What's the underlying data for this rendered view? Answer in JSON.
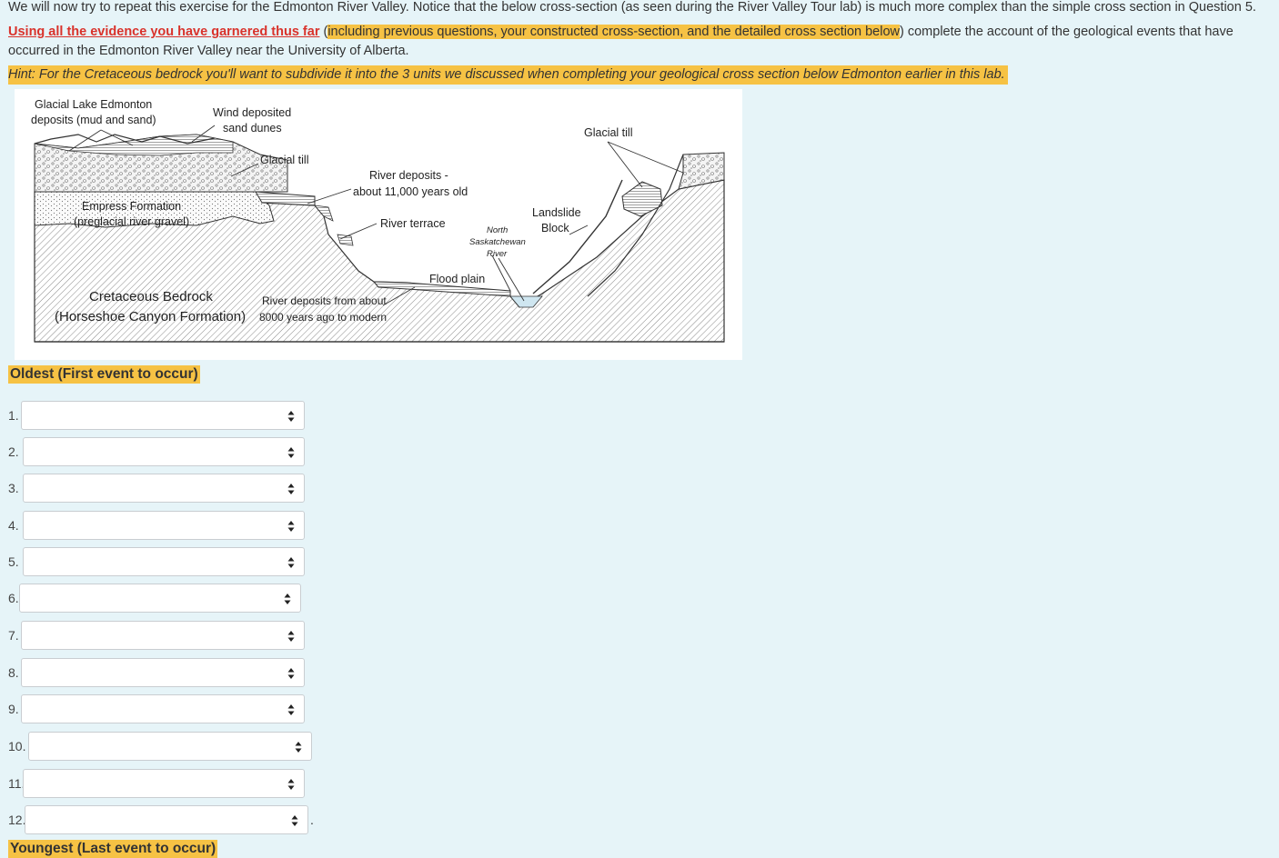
{
  "intro": "We will now try to repeat this exercise for the Edmonton River Valley. Notice that the below cross-section (as seen during the River Valley Tour lab) is much more complex than the simple cross section in Question 5.",
  "instruction": {
    "red": "Using all the evidence you have garnered thus far",
    "open_paren": " (",
    "highlight": "including previous questions, your constructed cross-section, and the detailed cross section below",
    "rest": ") complete the account of the geological events that have occurred in the Edmonton River Valley near the University of Alberta."
  },
  "hint": "Hint: For the Cretaceous bedrock you'll want to subdivide it into the 3 units we discussed when completing your geological cross section below Edmonton earlier in this lab.",
  "figure": {
    "glacial_lake_1": "Glacial Lake Edmonton",
    "glacial_lake_2": "deposits (mud and sand)",
    "wind_1": "Wind deposited",
    "wind_2": "sand dunes",
    "glacial_till_left": "Glacial till",
    "glacial_till_right": "Glacial till",
    "river_dep_1": "River deposits -",
    "river_dep_2": "about 11,000 years old",
    "empress_1": "Empress Formation",
    "empress_2": "(preglacial river gravel)",
    "river_terrace": "River terrace",
    "nsr_1": "North",
    "nsr_2": "Saskatchewan",
    "nsr_3": "River",
    "landslide_1": "Landslide",
    "landslide_2": "Block",
    "flood_plain": "Flood plain",
    "bedrock_1": "Cretaceous Bedrock",
    "bedrock_2": "(Horseshoe Canyon Formation)",
    "river_8000_1": "River deposits from about",
    "river_8000_2": "8000 years ago to modern"
  },
  "oldest_label": "Oldest (First event to occur)",
  "youngest_label": "Youngest (Last event to occur)",
  "events": [
    {
      "num": "1.",
      "value": ""
    },
    {
      "num": "2.",
      "value": ""
    },
    {
      "num": "3.",
      "value": ""
    },
    {
      "num": "4.",
      "value": ""
    },
    {
      "num": "5.",
      "value": ""
    },
    {
      "num": "6.",
      "value": ""
    },
    {
      "num": "7.",
      "value": ""
    },
    {
      "num": "8.",
      "value": ""
    },
    {
      "num": "9.",
      "value": ""
    },
    {
      "num": "10.",
      "value": ""
    },
    {
      "num": "11.",
      "value": ""
    },
    {
      "num": "12.",
      "value": ""
    }
  ],
  "trailing_period": "."
}
